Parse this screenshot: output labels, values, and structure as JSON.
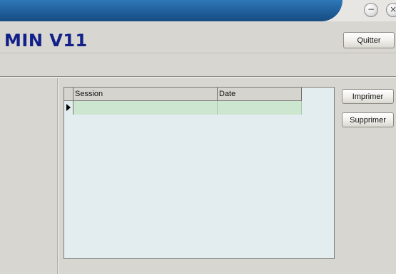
{
  "window": {
    "title": "MIN V11",
    "minimize_glyph": "−",
    "close_glyph": "×"
  },
  "toolbar": {
    "quit_label": "Quitter"
  },
  "actions": {
    "print_label": "Imprimer",
    "delete_label": "Supprimer"
  },
  "grid": {
    "columns": [
      "Session",
      "Date"
    ],
    "rows": [
      {
        "session": "",
        "date": "",
        "selected": true
      }
    ]
  },
  "colors": {
    "title_text": "#12208a",
    "titlebar": "#1f5e9a",
    "grid_background": "#e3ecee",
    "selected_row": "#cde6cf"
  }
}
